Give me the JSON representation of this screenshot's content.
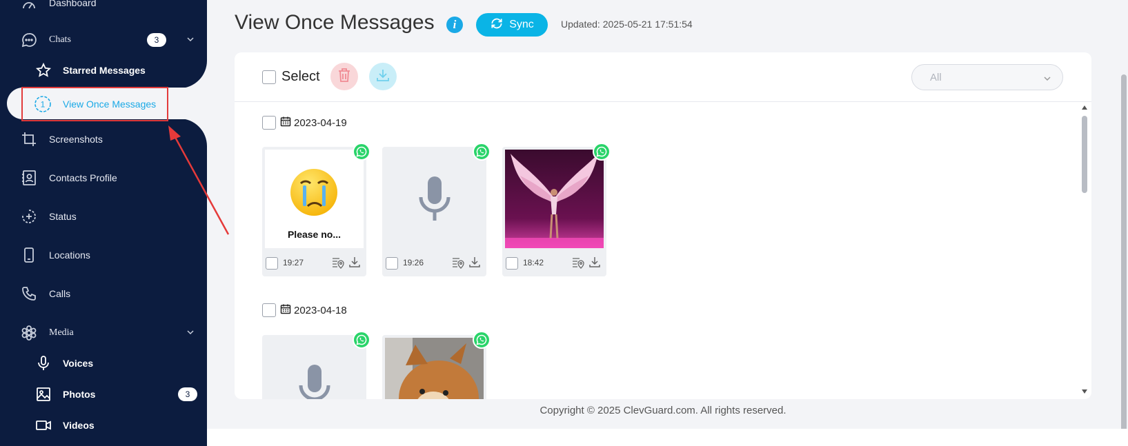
{
  "sidebar": {
    "items": [
      {
        "label": "Dashboard",
        "icon": "dashboard-icon"
      },
      {
        "label": "Chats",
        "icon": "chat-icon",
        "badge": "3"
      },
      {
        "label": "Starred Messages",
        "icon": "star-icon"
      },
      {
        "label": "View Once Messages",
        "icon": "view-once-icon"
      },
      {
        "label": "Screenshots",
        "icon": "crop-icon"
      },
      {
        "label": "Contacts Profile",
        "icon": "contact-card-icon"
      },
      {
        "label": "Status",
        "icon": "status-icon"
      },
      {
        "label": "Locations",
        "icon": "phone-icon"
      },
      {
        "label": "Calls",
        "icon": "call-icon"
      },
      {
        "label": "Media",
        "icon": "media-icon"
      },
      {
        "label": "Voices",
        "icon": "microphone-icon"
      },
      {
        "label": "Photos",
        "icon": "photo-icon",
        "badge": "3"
      },
      {
        "label": "Videos",
        "icon": "video-icon"
      }
    ]
  },
  "header": {
    "title": "View Once Messages",
    "info": "i",
    "sync_label": "Sync",
    "updated": "Updated: 2025-05-21 17:51:54"
  },
  "toolbar": {
    "select_label": "Select",
    "filter_value": "All"
  },
  "groups": [
    {
      "date": "2023-04-19",
      "items": [
        {
          "type": "image",
          "caption": "Please no...",
          "time": "19:27"
        },
        {
          "type": "voice",
          "time": "19:26"
        },
        {
          "type": "image",
          "time": "18:42"
        }
      ]
    },
    {
      "date": "2023-04-18",
      "items": [
        {
          "type": "voice"
        },
        {
          "type": "image"
        }
      ]
    }
  ],
  "footer": "Copyright © 2025 ClevGuard.com. All rights reserved.",
  "colors": {
    "sidebar_bg": "#0c1c3f",
    "accent": "#0ab4e6",
    "whatsapp": "#2ad46a",
    "highlight": "#e23b3b"
  }
}
